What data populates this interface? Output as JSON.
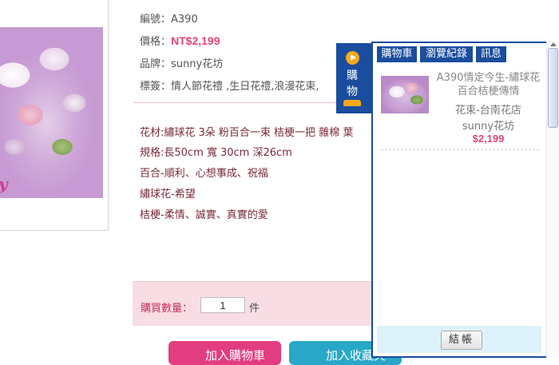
{
  "product": {
    "image_text": "y",
    "code_label": "編號：",
    "code_value": "A390",
    "price_label": "價格：",
    "price_value": "NT$2,199",
    "brand_label": "品牌：",
    "brand_value": "sunny花坊",
    "tags_label": "標簽：",
    "tags_value": "情人節花禮 ,生日花禮,浪漫花束,"
  },
  "description": [
    "花材:繡球花 3朵 粉百合一束 桔梗一把 雜棉 葉",
    "規格:長50cm 寬 30cm 深26cm",
    "百合-順利、心想事成、祝福",
    "繡球花-希望",
    "桔梗-柔情、誠實、真實的愛"
  ],
  "purchase": {
    "qty_label": "購買數量：",
    "qty_value": "1",
    "qty_unit": "件",
    "add_cart": "加入購物車",
    "add_fav": "加入收藏夾"
  },
  "cart_tab": {
    "line1": "購",
    "line2": "物"
  },
  "panel": {
    "tabs": [
      "購物車",
      "瀏覽紀錄",
      "訊息"
    ],
    "item": {
      "name": "A390情定今生-繡球花百合桔梗傳情",
      "shop": "花束-台南花店",
      "brand": "sunny花坊",
      "price": "$2,199"
    },
    "checkout": "結帳"
  },
  "colors": {
    "accent_pink": "#e0457b",
    "panel_blue": "#1a4d9e",
    "cart_button": "#e23d80",
    "fav_button": "#28a7c9"
  }
}
